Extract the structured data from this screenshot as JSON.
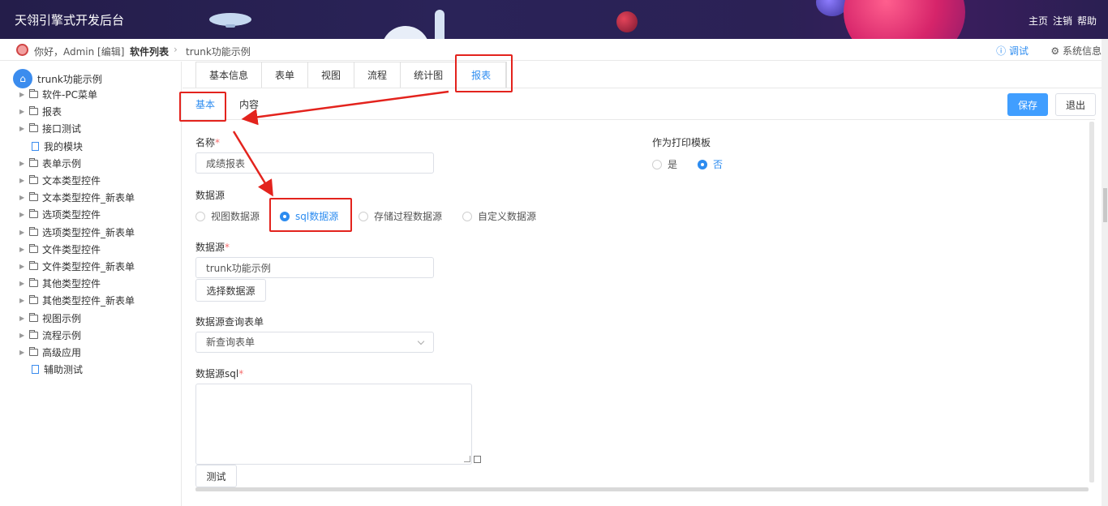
{
  "header": {
    "title": "天翎引擎式开发后台",
    "nav": [
      "主页",
      "注销",
      "帮助"
    ]
  },
  "subbar": {
    "greeting": "你好，Admin [编辑]",
    "breadcrumb_list": "软件列表",
    "breadcrumb_current": "trunk功能示例",
    "debug": "ⓘ 调试",
    "sysinfo": "⚙ 系统信息"
  },
  "sidebar": {
    "root": "trunk功能示例",
    "items": [
      {
        "label": "软件-PC菜单",
        "type": "folder"
      },
      {
        "label": "报表",
        "type": "folder"
      },
      {
        "label": "接口测试",
        "type": "folder"
      },
      {
        "label": "我的模块",
        "type": "file"
      },
      {
        "label": "表单示例",
        "type": "folder"
      },
      {
        "label": "文本类型控件",
        "type": "folder"
      },
      {
        "label": "文本类型控件_新表单",
        "type": "folder"
      },
      {
        "label": "选项类型控件",
        "type": "folder"
      },
      {
        "label": "选项类型控件_新表单",
        "type": "folder"
      },
      {
        "label": "文件类型控件",
        "type": "folder"
      },
      {
        "label": "文件类型控件_新表单",
        "type": "folder"
      },
      {
        "label": "其他类型控件",
        "type": "folder"
      },
      {
        "label": "其他类型控件_新表单",
        "type": "folder"
      },
      {
        "label": "视图示例",
        "type": "folder"
      },
      {
        "label": "流程示例",
        "type": "folder"
      },
      {
        "label": "高级应用",
        "type": "folder"
      },
      {
        "label": "辅助测试",
        "type": "file"
      }
    ]
  },
  "tabs_outer": [
    "基本信息",
    "表单",
    "视图",
    "流程",
    "统计图",
    "报表"
  ],
  "tabs_inner": [
    "基本",
    "内容"
  ],
  "toolbar": {
    "save": "保存",
    "exit": "退出"
  },
  "form": {
    "name_label": "名称",
    "name_value": "成绩报表",
    "print_label": "作为打印模板",
    "print_yes": "是",
    "print_no": "否",
    "ds_type_label": "数据源",
    "ds_types": [
      "视图数据源",
      "sql数据源",
      "存储过程数据源",
      "自定义数据源"
    ],
    "ds_label": "数据源",
    "ds_value": "trunk功能示例",
    "ds_button": "选择数据源",
    "query_label": "数据源查询表单",
    "query_value": "新查询表单",
    "sql_label": "数据源sql",
    "test_button": "测试"
  },
  "colors": {
    "accent": "#2d8cf0",
    "annotation": "#e3231d",
    "header_bg": "#241d4a"
  }
}
